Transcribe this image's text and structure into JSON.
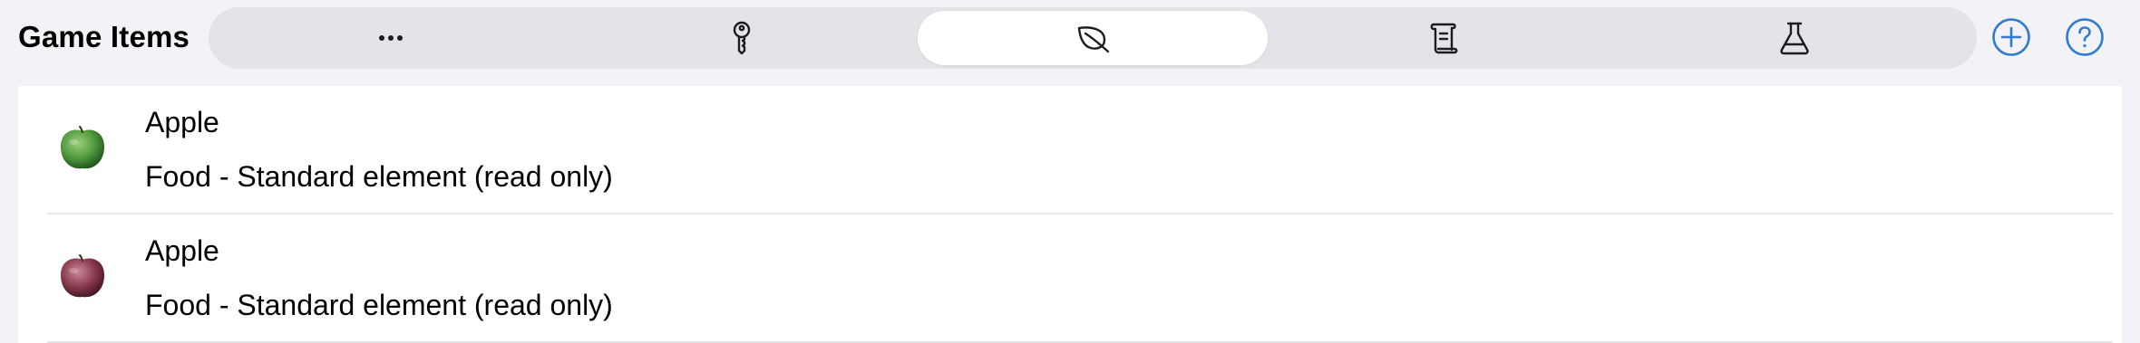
{
  "header": {
    "title": "Game Items"
  },
  "segments": [
    {
      "icon": "ellipsis-icon",
      "selected": false
    },
    {
      "icon": "key-icon",
      "selected": false
    },
    {
      "icon": "leaf-icon",
      "selected": true
    },
    {
      "icon": "scroll-icon",
      "selected": false
    },
    {
      "icon": "flask-icon",
      "selected": false
    }
  ],
  "actions": {
    "add_icon": "plus-circle-icon",
    "help_icon": "question-circle-icon"
  },
  "colors": {
    "accent": "#2f7bd4",
    "segment_track": "#e3e3e8",
    "background": "#f2f2f7",
    "separator": "#e5e5ea"
  },
  "items": [
    {
      "icon": "green-apple-icon",
      "title": "Apple",
      "subtitle": "Food - Standard element (read only)"
    },
    {
      "icon": "red-apple-icon",
      "title": "Apple",
      "subtitle": "Food - Standard element (read only)"
    }
  ]
}
